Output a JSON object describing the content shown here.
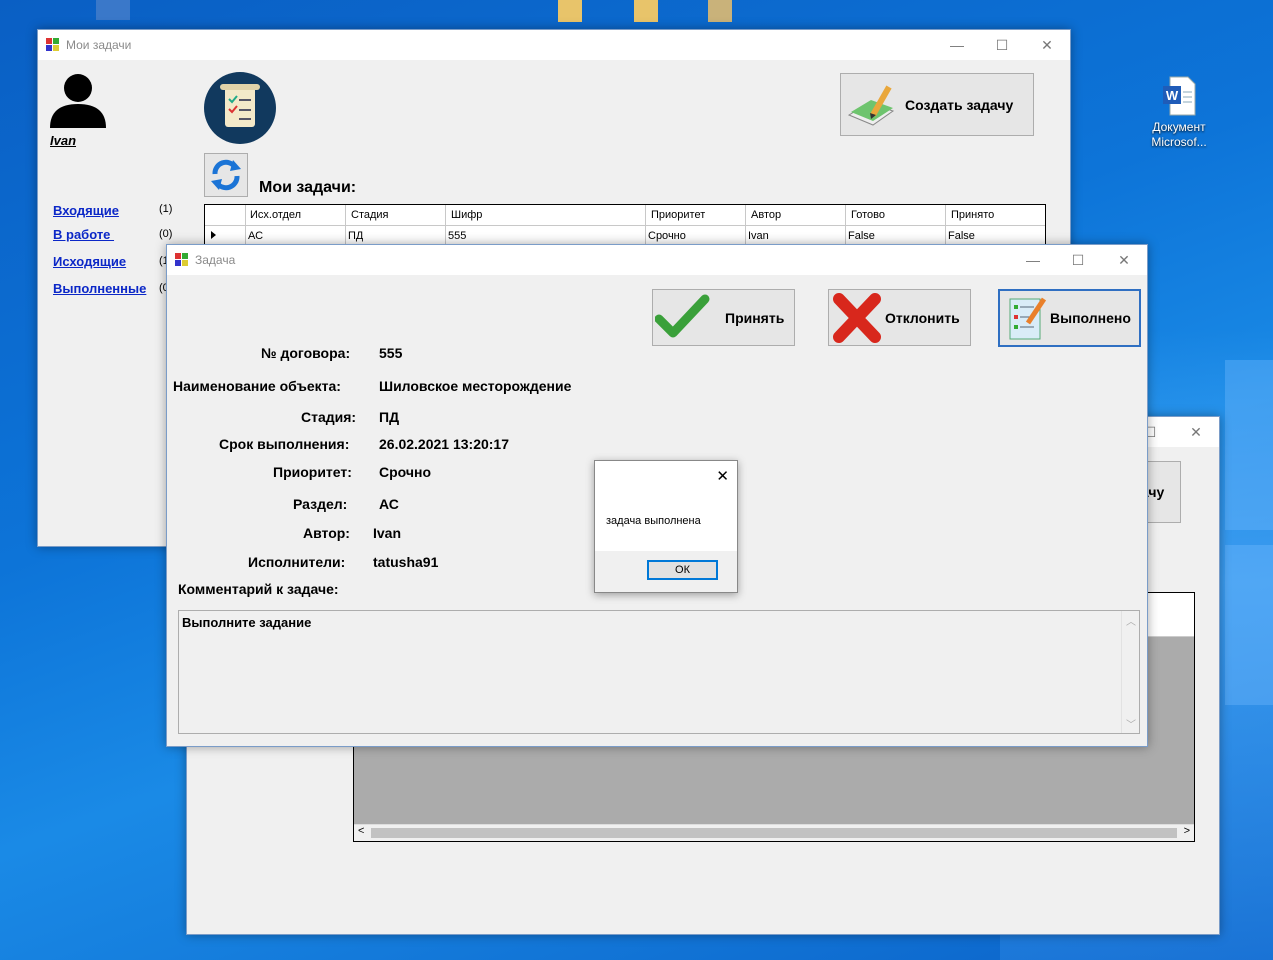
{
  "desktop": {
    "file_icon_label_line1": "Документ",
    "file_icon_label_line2": "Microsof..."
  },
  "main_window": {
    "title": "Мои задачи",
    "user_name": "Ivan",
    "section_title": "Мои задачи:",
    "create_button": "Создать задачу",
    "nav": [
      {
        "label": "Входящие",
        "count": "(1)"
      },
      {
        "label": "В работе ",
        "count": "(0)"
      },
      {
        "label": "Исходящие",
        "count": "(1"
      },
      {
        "label": "Выполненные",
        "count": "(0"
      }
    ],
    "grid": {
      "columns": [
        "Исх.отдел",
        "Стадия",
        "Шифр",
        "Приоритет",
        "Автор",
        "Готово",
        "Принято"
      ],
      "rows": [
        [
          "АС",
          "ПД",
          "555",
          "Срочно",
          "Ivan",
          "False",
          "False"
        ]
      ]
    }
  },
  "back_window": {
    "button_fragment": "дачу"
  },
  "task_window": {
    "title": "Задача",
    "accept_button": "Принять",
    "reject_button": "Отклонить",
    "done_button": "Выполнено",
    "fields": {
      "contract_label": "№ договора:",
      "contract_value": "555",
      "object_label": "Наименование объекта:",
      "object_value": "Шиловское месторождение",
      "stage_label": "Стадия:",
      "stage_value": "ПД",
      "deadline_label": "Срок выполнения:",
      "deadline_value": "26.02.2021 13:20:17",
      "priority_label": "Приоритет:",
      "priority_value": "Срочно",
      "section_label": "Раздел:",
      "section_value": "АС",
      "author_label": "Автор:",
      "author_value": "Ivan",
      "executors_label": "Исполнители:",
      "executors_value": "tatusha91",
      "comment_label": "Комментарий к задаче:",
      "comment_value": "Выполните задание"
    }
  },
  "message_box": {
    "text": "задача выполнена",
    "ok_button": "ОК"
  }
}
